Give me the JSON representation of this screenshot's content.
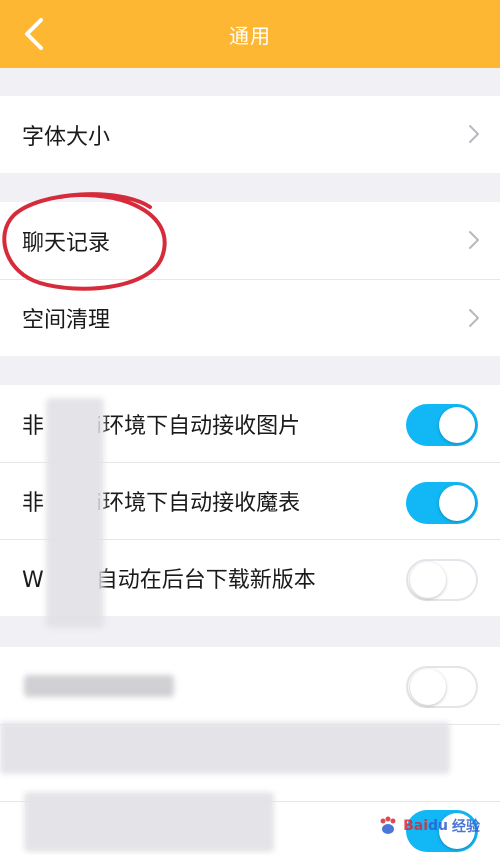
{
  "header": {
    "title": "通用",
    "back_icon": "chevron-left-icon",
    "color": "#fdb733"
  },
  "groups": [
    {
      "items": [
        {
          "label": "字体大小"
        }
      ]
    },
    {
      "items": [
        {
          "label": "聊天记录"
        },
        {
          "label": "空间清理"
        }
      ]
    },
    {
      "items": [
        {
          "label": "非Wi-Fi环境下自动接收图片",
          "toggle": "on"
        },
        {
          "label": "非Wi-Fi环境下自动接收魔表",
          "toggle": "on"
        },
        {
          "label": "Wi-Fi下自动在后台下载新版本",
          "toggle": "off"
        }
      ]
    },
    {
      "items": [
        {
          "label": "",
          "toggle": "off"
        },
        {
          "label": ""
        },
        {
          "label": "",
          "toggle": "on"
        }
      ]
    }
  ],
  "visible_labels": {
    "toggle_1": "非",
    "toggle_1_rest": "i环境下自动接收图片",
    "toggle_2": "非",
    "toggle_2_rest": "i环境下自动接收魔表",
    "toggle_3": "W",
    "toggle_3_rest": "自动在后台下载新版本"
  },
  "annotation": {
    "circle_color": "#d62b3a",
    "circled_item": "聊天记录"
  },
  "watermark": {
    "brand": "Bai",
    "brand2": "du",
    "text": "经验"
  },
  "colors": {
    "toggle_on": "#12b7f5",
    "background": "#f0f0f5"
  }
}
